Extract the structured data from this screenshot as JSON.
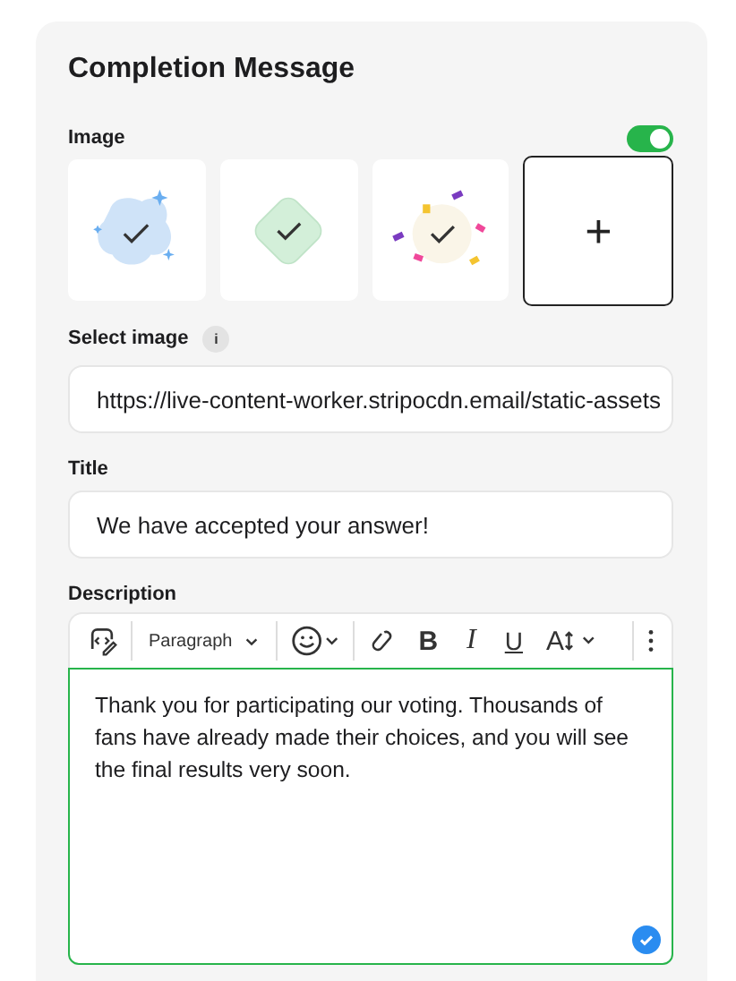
{
  "panel": {
    "title": "Completion Message"
  },
  "image": {
    "label": "Image",
    "on": true,
    "options": [
      {
        "kind": "blob",
        "selected": false
      },
      {
        "kind": "diamond",
        "selected": false
      },
      {
        "kind": "confetti",
        "selected": false
      },
      {
        "kind": "add",
        "symbol": "+",
        "selected": true
      }
    ]
  },
  "select_image": {
    "label": "Select image",
    "info": "i",
    "value": "https://live-content-worker.stripocdn.email/static-assets"
  },
  "title_field": {
    "label": "Title",
    "value": "We have accepted your answer!"
  },
  "description": {
    "label": "Description",
    "toolbar": {
      "format": "Paragraph",
      "bold": "B",
      "italic": "I",
      "underline": "U",
      "font_size": "A"
    },
    "text": "Thank you for participating our voting. Thousands of fans have already made their choices, and you will see the final results very soon.",
    "focused": true,
    "saved": true
  }
}
